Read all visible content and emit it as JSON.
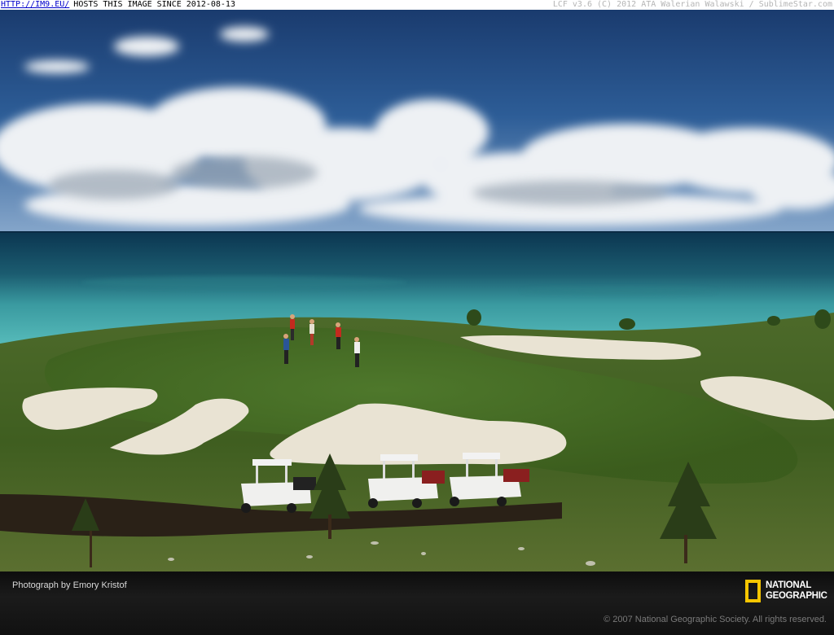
{
  "topbar": {
    "link_text": "HTTP://IM9.EU/",
    "notice": "HOSTS THIS IMAGE SINCE 2012-08-13",
    "credit": "LCF v3.6 (C) 2012 ATA Walerian Walawski / SublimeStar.com"
  },
  "caption": {
    "photographer": "Photograph by Emory Kristof",
    "copyright": "© 2007 National Geographic Society. All rights reserved."
  },
  "logo": {
    "line1": "NATIONAL",
    "line2": "GEOGRAPHIC",
    "frame_color": "#f7c600"
  },
  "photo": {
    "subject": "golf-course-by-the-sea"
  }
}
